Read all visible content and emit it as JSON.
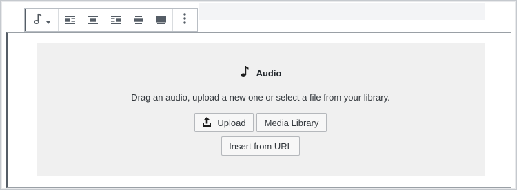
{
  "toolbar": {
    "block_type": "audio",
    "alignment_options": [
      "align-left",
      "align-center",
      "align-right",
      "wide-width",
      "full-width"
    ]
  },
  "placeholder": {
    "title": "Audio",
    "instructions": "Drag an audio, upload a new one or select a file from your library.",
    "upload_label": "Upload",
    "media_library_label": "Media Library",
    "insert_url_label": "Insert from URL"
  }
}
